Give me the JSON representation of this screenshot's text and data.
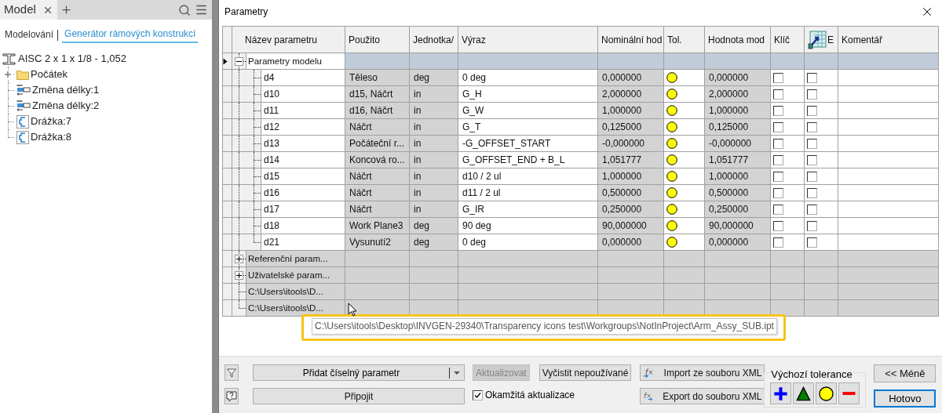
{
  "left_panel": {
    "tabs": [
      {
        "label": "Model",
        "selected": true
      }
    ],
    "modes": [
      {
        "label": "Modelování",
        "selected": false
      },
      {
        "label": "Generátor rámových konstrukcí",
        "selected": true
      }
    ],
    "tree": {
      "label": "AISC 2 x 1 x 1/8 - 1,052",
      "children": [
        {
          "kind": "folder",
          "label": "Počátek",
          "expanded": false
        },
        {
          "kind": "length",
          "label": "Změna délky:1"
        },
        {
          "kind": "length",
          "label": "Změna délky:2"
        },
        {
          "kind": "slot",
          "label": "Drážka:7"
        },
        {
          "kind": "slot",
          "label": "Drážka:8"
        }
      ]
    }
  },
  "dialog": {
    "title": "Parametry",
    "table": {
      "columns": [
        "Název parametru",
        "Použito",
        "Jednotka/",
        "Výraz",
        "Nominální hod",
        "Tol.",
        "Hodnota mod",
        "Klíč",
        "E",
        "Komentář"
      ],
      "groups": [
        {
          "kind": "section",
          "name": "Parametry modelu",
          "expanded": true,
          "selected": true,
          "rows": [
            {
              "name": "d4",
              "used_by": "Těleso",
              "unit": "deg",
              "expression": "0 deg",
              "nominal": "0,000000",
              "tolerance": {
                "kind": "nominal"
              },
              "model_value": "0,000000",
              "key": false,
              "export": false
            },
            {
              "name": "d10",
              "used_by": "d15, Náčrt",
              "unit": "in",
              "expression": "G_H",
              "nominal": "2,000000",
              "tolerance": {
                "kind": "nominal"
              },
              "model_value": "2,000000",
              "key": false,
              "export": false
            },
            {
              "name": "d11",
              "used_by": "d16, Náčrt",
              "unit": "in",
              "expression": "G_W",
              "nominal": "1,000000",
              "tolerance": {
                "kind": "nominal"
              },
              "model_value": "1,000000",
              "key": false,
              "export": false
            },
            {
              "name": "d12",
              "used_by": "Náčrt",
              "unit": "in",
              "expression": "G_T",
              "nominal": "0,125000",
              "tolerance": {
                "kind": "nominal"
              },
              "model_value": "0,125000",
              "key": false,
              "export": false
            },
            {
              "name": "d13",
              "used_by": "Počáteční r...",
              "unit": "in",
              "expression": "-G_OFFSET_START",
              "nominal": "-0,000000",
              "tolerance": {
                "kind": "nominal"
              },
              "model_value": "-0,000000",
              "key": false,
              "export": false
            },
            {
              "name": "d14",
              "used_by": "Koncová ro...",
              "unit": "in",
              "expression": "G_OFFSET_END + B_L",
              "nominal": "1,051777",
              "tolerance": {
                "kind": "nominal"
              },
              "model_value": "1,051777",
              "key": false,
              "export": false
            },
            {
              "name": "d15",
              "used_by": "Náčrt",
              "unit": "in",
              "expression": "d10 / 2 ul",
              "nominal": "1,000000",
              "tolerance": {
                "kind": "nominal"
              },
              "model_value": "1,000000",
              "key": false,
              "export": false
            },
            {
              "name": "d16",
              "used_by": "Náčrt",
              "unit": "in",
              "expression": "d11 / 2 ul",
              "nominal": "0,500000",
              "tolerance": {
                "kind": "nominal"
              },
              "model_value": "0,500000",
              "key": false,
              "export": false
            },
            {
              "name": "d17",
              "used_by": "Náčrt",
              "unit": "in",
              "expression": "G_IR",
              "nominal": "0,250000",
              "tolerance": {
                "kind": "nominal"
              },
              "model_value": "0,250000",
              "key": false,
              "export": false
            },
            {
              "name": "d18",
              "used_by": "Work Plane3",
              "unit": "deg",
              "expression": "90 deg",
              "nominal": "90,000000",
              "tolerance": {
                "kind": "nominal"
              },
              "model_value": "90,000000",
              "key": false,
              "export": false
            },
            {
              "name": "d21",
              "used_by": "Vysunutí2",
              "unit": "deg",
              "expression": "0 deg",
              "nominal": "0,000000",
              "tolerance": {
                "kind": "nominal"
              },
              "model_value": "0,000000",
              "key": false,
              "export": false
            }
          ]
        },
        {
          "kind": "section",
          "name": "Referenční param...",
          "expanded": false,
          "selected": false
        },
        {
          "kind": "section",
          "name": "Uživatelské param...",
          "expanded": false,
          "selected": false
        },
        {
          "kind": "file",
          "name": "C:\\Users\\itools\\D...",
          "selected": false
        },
        {
          "kind": "file",
          "name": "C:\\Users\\itools\\D...",
          "selected": false
        }
      ]
    },
    "tooltip": "C:\\Users\\itools\\Desktop\\INVGEN-29340\\Transparency icons test\\Workgroups\\NotInProject\\Arm_Assy_SUB.ipt",
    "footer": {
      "add_button": "Přidat číselný parametr",
      "link_button": "Připojit",
      "update_button": {
        "label": "Aktualizovat",
        "disabled": true
      },
      "purge_button": "Vyčistit nepoužívané",
      "import_button": "Import ze souboru XML",
      "export_button": "Export do souboru XML",
      "immediate_update": {
        "label": "Okamžitá aktualizace",
        "checked": true
      },
      "default_tolerance": {
        "label": "Výchozí tolerance",
        "options": [
          {
            "kind": "upper"
          },
          {
            "kind": "median"
          },
          {
            "kind": "nominal"
          },
          {
            "kind": "lower"
          }
        ]
      },
      "less_button": "<< Méně",
      "done_button": "Hotovo"
    }
  }
}
